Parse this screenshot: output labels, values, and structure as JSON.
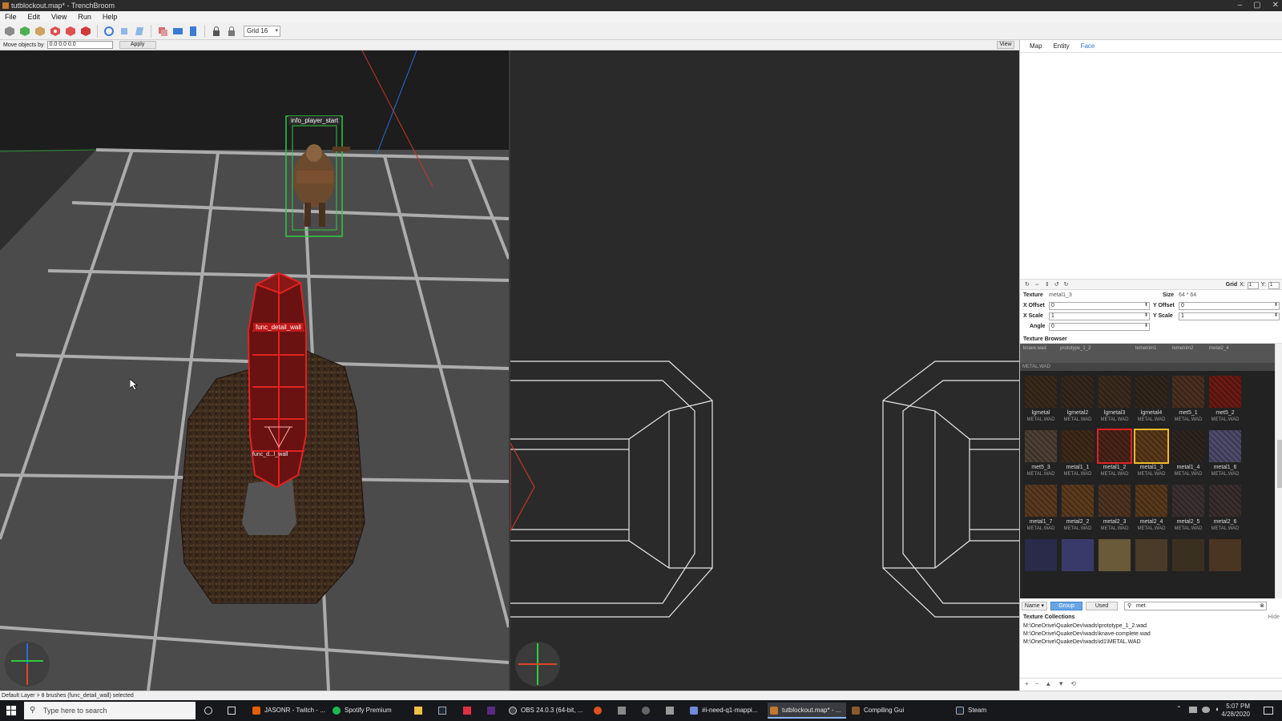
{
  "window": {
    "title": "tutblockout.map* - TrenchBroom",
    "controls": [
      "–",
      "▢",
      "✕"
    ]
  },
  "menu": [
    "File",
    "Edit",
    "View",
    "Run",
    "Help"
  ],
  "toolbar": {
    "tools": [
      "new-brush-tool-icon",
      "brush-tool-icon",
      "clip-tool-icon",
      "vertex-tool-icon",
      "edge-tool-icon",
      "face-tool-icon",
      "rotate-tool-icon",
      "scale-tool-icon",
      "shear-tool-icon",
      "duplicate-icon",
      "flip-horizontal-icon",
      "flip-vertical-icon",
      "texture-lock-icon",
      "uv-lock-icon"
    ],
    "grid_label": "Grid 16"
  },
  "options_bar": {
    "move_label": "Move objects by",
    "move_value": "0.0 0.0 0.0",
    "apply_label": "Apply",
    "view_label": "View"
  },
  "viewport_3d": {
    "entity_label_1": "info_player_start",
    "entity_label_2": "func_detail_wall",
    "entity_label_3": "func_d...l_wall"
  },
  "inspector": {
    "tabs": [
      "Map",
      "Entity",
      "Face"
    ],
    "active_tab": "Face",
    "uv_grid_label": "Grid",
    "uv_x": "X:",
    "uv_y": "Y:",
    "uv_x_value": "1",
    "uv_y_value": "1",
    "face": {
      "texture_label": "Texture",
      "texture_value": "metal1_3",
      "size_label": "Size",
      "size_value": "64 * 64",
      "x_offset_label": "X Offset",
      "x_offset_value": "0",
      "y_offset_label": "Y Offset",
      "y_offset_value": "0",
      "x_scale_label": "X Scale",
      "x_scale_value": "1",
      "y_scale_label": "Y Scale",
      "y_scale_value": "1",
      "angle_label": "Angle",
      "angle_value": "0"
    },
    "texture_browser": {
      "title": "Texture Browser",
      "group_label": "METAL.WAD",
      "prev_row": [
        "knave.wad",
        "prototype_1_2",
        "lemetrim1",
        "lemetrim2",
        "metal2_4"
      ],
      "textures": [
        {
          "name": "lgmetal",
          "wad": "METAL.WAD",
          "color": "#3a2a1c"
        },
        {
          "name": "lgmetal2",
          "wad": "METAL.WAD",
          "color": "#35281d"
        },
        {
          "name": "lgmetal3",
          "wad": "METAL.WAD",
          "color": "#3b2c1e"
        },
        {
          "name": "lgmetal4",
          "wad": "METAL.WAD",
          "color": "#33271c"
        },
        {
          "name": "met5_1",
          "wad": "METAL.WAD",
          "color": "#4a3020"
        },
        {
          "name": "met5_2",
          "wad": "METAL.WAD",
          "color": "#6a1a14"
        },
        {
          "name": "met5_3",
          "wad": "METAL.WAD",
          "color": "#4d3f33"
        },
        {
          "name": "metal1_1",
          "wad": "METAL.WAD",
          "color": "#3e2a18"
        },
        {
          "name": "metal1_2",
          "wad": "METAL.WAD",
          "color": "#4a2418"
        },
        {
          "name": "metal1_3",
          "wad": "METAL.WAD",
          "color": "#5a3a1a"
        },
        {
          "name": "metal1_4",
          "wad": "METAL.WAD",
          "color": "#2e2520"
        },
        {
          "name": "metal1_6",
          "wad": "METAL.WAD",
          "color": "#4d4a6a"
        },
        {
          "name": "metal1_7",
          "wad": "METAL.WAD",
          "color": "#5a3a20"
        },
        {
          "name": "metal2_2",
          "wad": "METAL.WAD",
          "color": "#5c3b1d"
        },
        {
          "name": "metal2_3",
          "wad": "METAL.WAD",
          "color": "#4f3420"
        },
        {
          "name": "metal2_4",
          "wad": "METAL.WAD",
          "color": "#58391c"
        },
        {
          "name": "metal2_5",
          "wad": "METAL.WAD",
          "color": "#3b3030"
        },
        {
          "name": "metal2_6",
          "wad": "METAL.WAD",
          "color": "#3a2e2e"
        }
      ],
      "selected_red": "metal1_2",
      "selected_yellow": "metal1_3",
      "sort_label": "Name",
      "group_btn": "Group",
      "used_btn": "Used",
      "filter_value": "met"
    },
    "collections": {
      "title": "Texture Collections",
      "hide_label": "Hide",
      "items": [
        "M:\\OneDrive\\QuakeDev\\wads\\prototype_1_2.wad",
        "M:\\OneDrive\\QuakeDev\\wads\\knave-complete.wad",
        "M:\\OneDrive\\QuakeDev\\wads\\id1\\METAL.WAD"
      ],
      "footer_buttons": [
        "+",
        "−",
        "▲",
        "▼",
        "⟲"
      ]
    }
  },
  "status": "Default Layer > 8 brushes (func_detail_wall) selected",
  "taskbar": {
    "search_placeholder": "Type here to search",
    "apps": [
      {
        "label": "JASONR - Twitch - ...",
        "color": "#e66000"
      },
      {
        "label": "Spotify Premium",
        "color": "#1db954"
      },
      {
        "label": "OBS 24.0.3 (64-bit, ...",
        "color": "#444"
      },
      {
        "label": "#i-need-q1-mappi...",
        "color": "#7289da"
      },
      {
        "label": "tutblockout.map* - ...",
        "color": "#c0782c"
      },
      {
        "label": "Compiling Gui",
        "color": "#8a5a2a"
      },
      {
        "label": "Steam",
        "color": "#1b2838"
      }
    ],
    "time": "5:07 PM",
    "date": "4/28/2020"
  },
  "colors": {
    "accent": "#2b78d0",
    "selection": "#e02222",
    "entity_box": "#2ecc40"
  }
}
